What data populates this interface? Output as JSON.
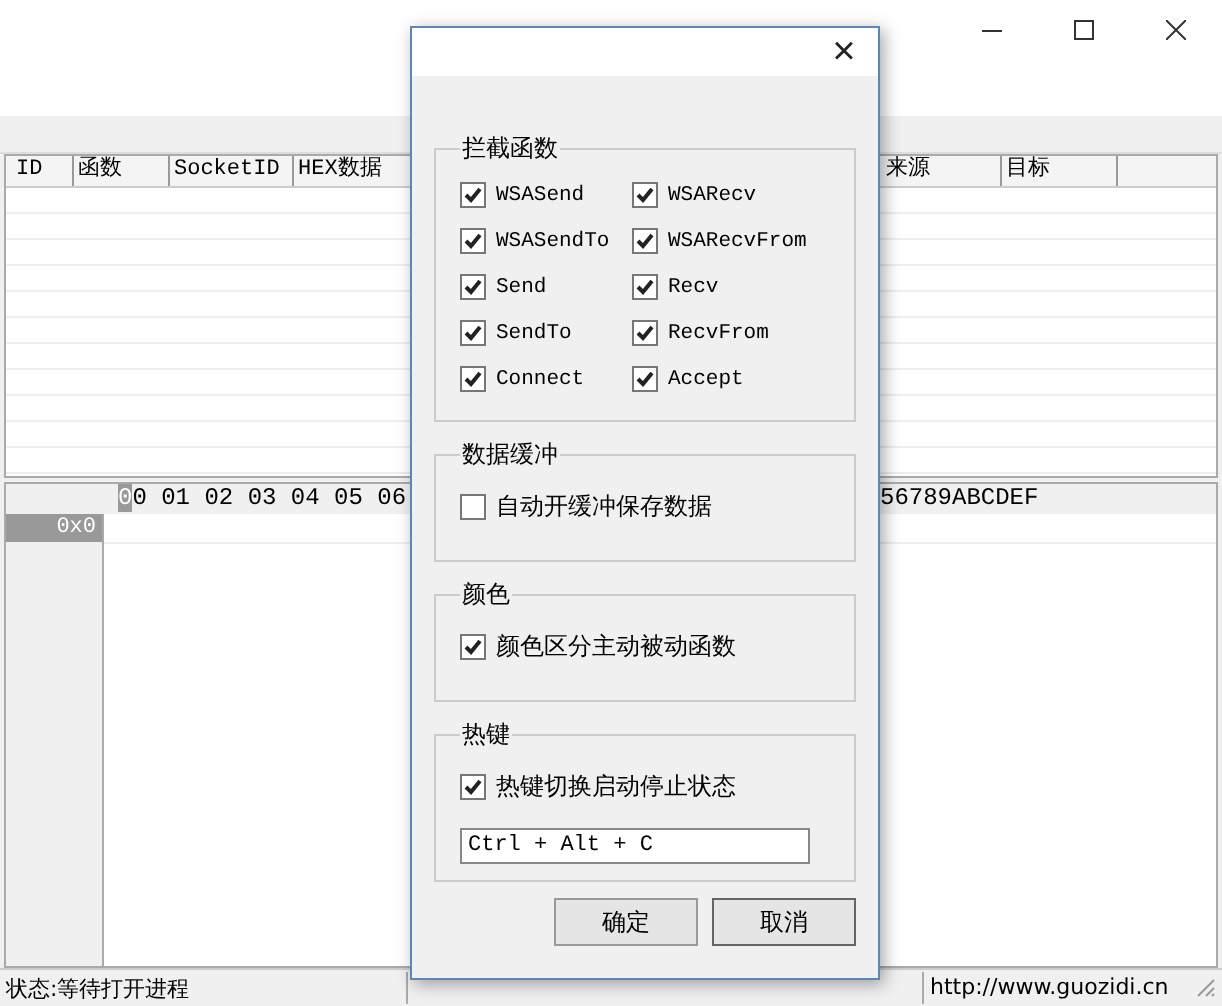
{
  "packet_list": {
    "columns": [
      {
        "label": "ID"
      },
      {
        "label": "函数"
      },
      {
        "label": "SocketID"
      },
      {
        "label": "HEX数据"
      },
      {
        "label": "来源"
      },
      {
        "label": "目标"
      }
    ]
  },
  "hex_view": {
    "cursor_digit": "0",
    "header_rest": "0 01 02 03 04 05 06",
    "ascii_header": "56789ABCDEF",
    "rows": [
      "0x0"
    ]
  },
  "status_bar": {
    "status": "状态:等待打开进程",
    "url": "http://www.guozidi.cn"
  },
  "dialog": {
    "close": "×",
    "groups": [
      {
        "title": "拦截函数",
        "kind": "grid",
        "items": [
          {
            "label": "WSASend",
            "checked": true
          },
          {
            "label": "WSARecv",
            "checked": true
          },
          {
            "label": "WSASendTo",
            "checked": true
          },
          {
            "label": "WSARecvFrom",
            "checked": true
          },
          {
            "label": "Send",
            "checked": true
          },
          {
            "label": "Recv",
            "checked": true
          },
          {
            "label": "SendTo",
            "checked": true
          },
          {
            "label": "RecvFrom",
            "checked": true
          },
          {
            "label": "Connect",
            "checked": true
          },
          {
            "label": "Accept",
            "checked": true
          }
        ]
      },
      {
        "title": "数据缓冲",
        "kind": "list",
        "items": [
          {
            "label": "自动开缓冲保存数据",
            "checked": false
          }
        ]
      },
      {
        "title": "颜色",
        "kind": "list",
        "items": [
          {
            "label": "颜色区分主动被动函数",
            "checked": true
          }
        ]
      },
      {
        "title": "热键",
        "kind": "list",
        "items": [
          {
            "label": "热键切换启动停止状态",
            "checked": true
          }
        ],
        "field": "Ctrl + Alt + C"
      }
    ],
    "buttons": [
      "确定",
      "取消"
    ]
  }
}
